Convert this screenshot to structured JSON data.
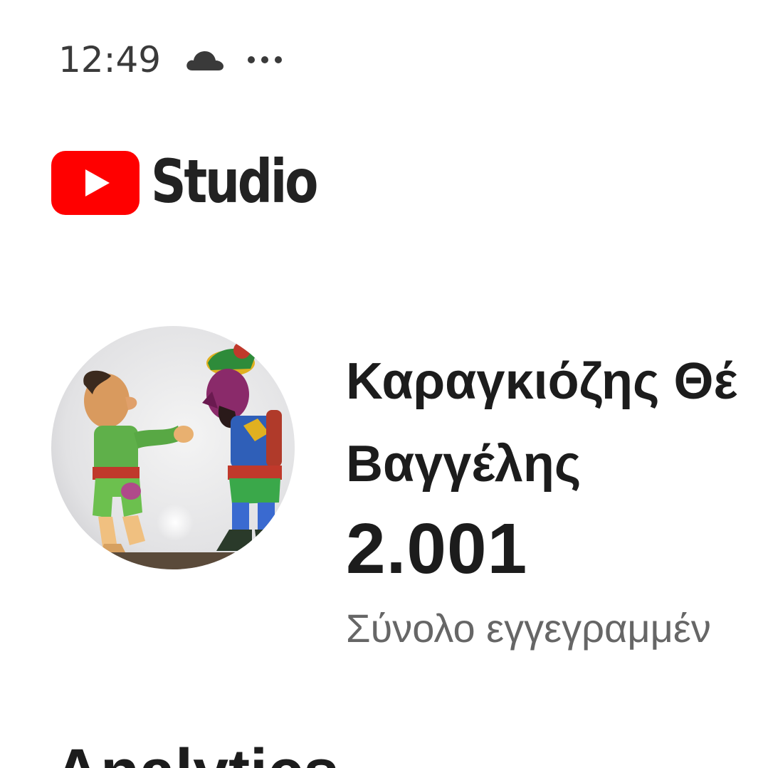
{
  "status_bar": {
    "time": "12:49",
    "icons": [
      "cloud-icon",
      "more-icon"
    ]
  },
  "logo": {
    "text": "Studio",
    "icon": "youtube-play-icon",
    "brand_color": "#ff0000"
  },
  "channel": {
    "name_line1": "Καραγκιόζης Θέ",
    "name_line2": "Βαγγέλης",
    "subscriber_count": "2.001",
    "subscriber_label": "Σύνολο εγγεγραμμέν"
  },
  "next_section": {
    "heading": "Analytics"
  },
  "colors": {
    "text_primary": "#1c1c1c",
    "text_secondary": "#666666",
    "background": "#ffffff"
  }
}
